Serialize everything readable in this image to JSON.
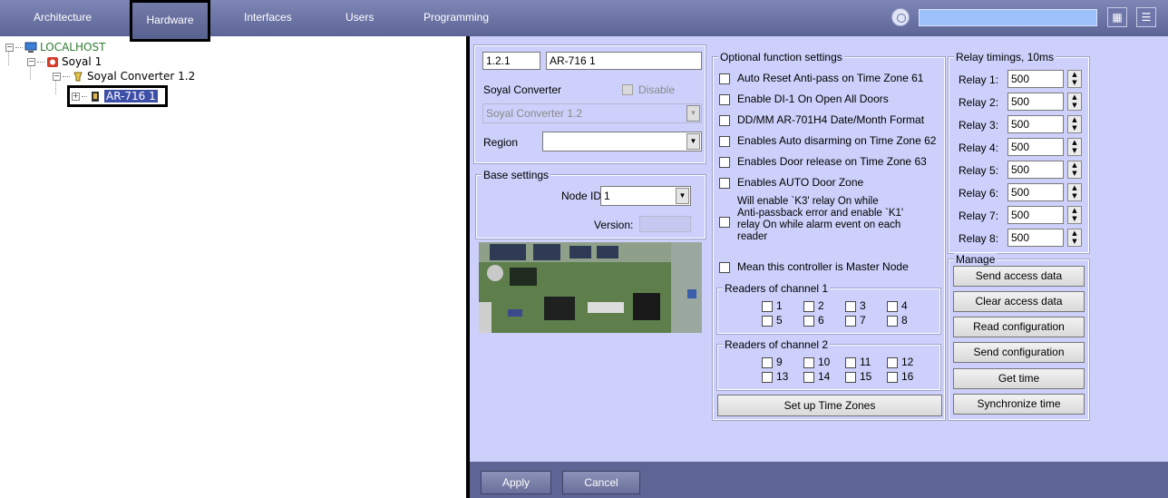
{
  "tabs": [
    {
      "label": "Architecture"
    },
    {
      "label": "Hardware"
    },
    {
      "label": "Interfaces"
    },
    {
      "label": "Users"
    },
    {
      "label": "Programming"
    }
  ],
  "tree": {
    "root": "LOCALHOST",
    "node1": "Soyal 1",
    "node2": "Soyal Converter 1.2",
    "node3": "AR-716 1"
  },
  "form": {
    "id_prefix": "1.2.1",
    "name_value": "AR-716 1",
    "parent_label": "Soyal Converter",
    "disable_label": "Disable",
    "parent_value": "Soyal Converter 1.2",
    "region_label": "Region",
    "region_value": ""
  },
  "base": {
    "title": "Base settings",
    "node_id_label": "Node ID:",
    "node_id_value": "1",
    "version_label": "Version:",
    "version_value": ""
  },
  "optional": {
    "title": "Optional function settings",
    "items": [
      "Auto Reset Anti-pass on Time Zone 61",
      "Enable DI-1 On Open All Doors",
      "DD/MM AR-701H4 Date/Month Format",
      "Enables Auto disarming on Time Zone 62",
      "Enables Door release on Time Zone 63",
      "Enables AUTO Door  Zone",
      "Will enable `K3' relay On while Anti-passback error and enable `K1' relay On while alarm event on each reader",
      "Mean this controller is Master Node"
    ],
    "long_line1": "Will enable `K3' relay On while",
    "long_line2": "Anti-passback error and enable `K1'",
    "long_line3": "relay On while alarm event on each",
    "long_line4": "reader"
  },
  "readers1": {
    "title": "Readers of channel 1",
    "items": [
      "1",
      "2",
      "3",
      "4",
      "5",
      "6",
      "7",
      "8"
    ]
  },
  "readers2": {
    "title": "Readers of channel 2",
    "items": [
      "9",
      "10",
      "11",
      "12",
      "13",
      "14",
      "15",
      "16"
    ]
  },
  "timezones_button": "Set up Time Zones",
  "relay": {
    "title": "Relay timings, 10ms",
    "items": [
      {
        "label": "Relay 1:",
        "value": "500"
      },
      {
        "label": "Relay 2:",
        "value": "500"
      },
      {
        "label": "Relay 3:",
        "value": "500"
      },
      {
        "label": "Relay 4:",
        "value": "500"
      },
      {
        "label": "Relay 5:",
        "value": "500"
      },
      {
        "label": "Relay 6:",
        "value": "500"
      },
      {
        "label": "Relay 7:",
        "value": "500"
      },
      {
        "label": "Relay 8:",
        "value": "500"
      }
    ]
  },
  "manage": {
    "title": "Manage",
    "buttons": [
      "Send access data",
      "Clear access data",
      "Read configuration",
      "Send configuration",
      "Get time",
      "Synchronize time"
    ]
  },
  "footer": {
    "apply": "Apply",
    "cancel": "Cancel"
  },
  "colors": {
    "topbar": "#6b73a5",
    "panel": "#ccd0fa",
    "search": "#9cc1fb",
    "footer": "#5e6595"
  },
  "icons": [
    "target-icon",
    "grid-view-icon",
    "list-view-icon",
    "computer-icon",
    "soyal-icon",
    "converter-icon",
    "controller-icon"
  ]
}
